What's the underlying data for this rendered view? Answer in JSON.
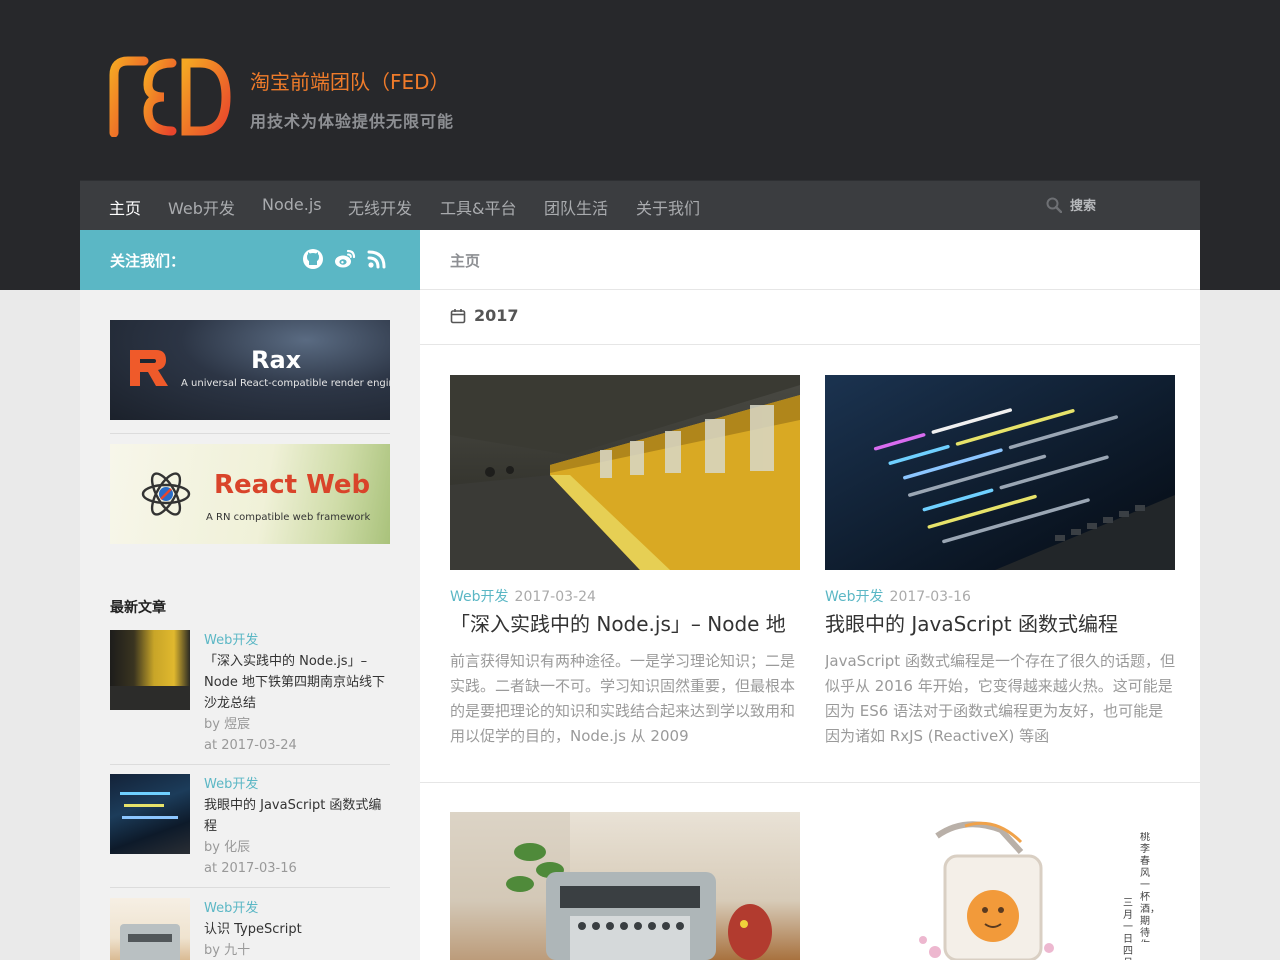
{
  "site": {
    "title": "淘宝前端团队（FED）",
    "description": "用技术为体验提供无限可能",
    "logo_text": "FED"
  },
  "nav": {
    "items": [
      "主页",
      "Web开发",
      "Node.js",
      "无线开发",
      "工具&平台",
      "团队生活",
      "关于我们"
    ],
    "search_label": "搜索"
  },
  "follow": {
    "label": "关注我们："
  },
  "sidebar": {
    "banners": [
      {
        "title": "Rax",
        "subtitle": "A universal React-compatible render engine."
      },
      {
        "title": "React Web",
        "subtitle": "A RN compatible web framework"
      }
    ],
    "recent_title": "最新文章",
    "recent": [
      {
        "category": "Web开发",
        "title": "「深入实践中的 Node.js」– Node 地下铁第四期南京站线下沙龙总结",
        "author": "by 煜宸",
        "date": "at 2017-03-24"
      },
      {
        "category": "Web开发",
        "title": "我眼中的 JavaScript 函数式编程",
        "author": "by 化辰",
        "date": "at 2017-03-16"
      },
      {
        "category": "Web开发",
        "title": "认识 TypeScript",
        "author": "by 九十"
      }
    ]
  },
  "main": {
    "breadcrumb": "主页",
    "archive_label": "2017",
    "posts": [
      {
        "category": "Web开发",
        "date": "2017-03-24",
        "title": "「深入实践中的 Node.js」– Node 地",
        "excerpt": "前言获得知识有两种途径。一是学习理论知识；二是实践。二者缺一不可。学习知识固然重要，但最根本的是要把理论的知识和实践结合起来达到学以致用和用以促学的目的，Node.js 从 2009"
      },
      {
        "category": "Web开发",
        "date": "2017-03-16",
        "title": "我眼中的 JavaScript 函数式编程",
        "excerpt": "JavaScript 函数式编程是一个存在了很久的话题，但似乎从 2016 年开始，它变得越来越火热。这可能是因为 ES6 语法对于函数式编程更为友好，也可能是因为诸如 RxJS (ReactiveX) 等函"
      }
    ],
    "poster_caption": "桃李春风一杯酒，期待你的到来",
    "poster_date": "三月一日 四月十"
  },
  "colors": {
    "accent": "#5bb7c5",
    "brand_orange": "#ef7b2a",
    "header_bg": "#27282b",
    "nav_bg": "#3b3d40"
  },
  "icons": [
    "search-icon",
    "github-icon",
    "weibo-icon",
    "rss-icon",
    "calendar-icon"
  ]
}
